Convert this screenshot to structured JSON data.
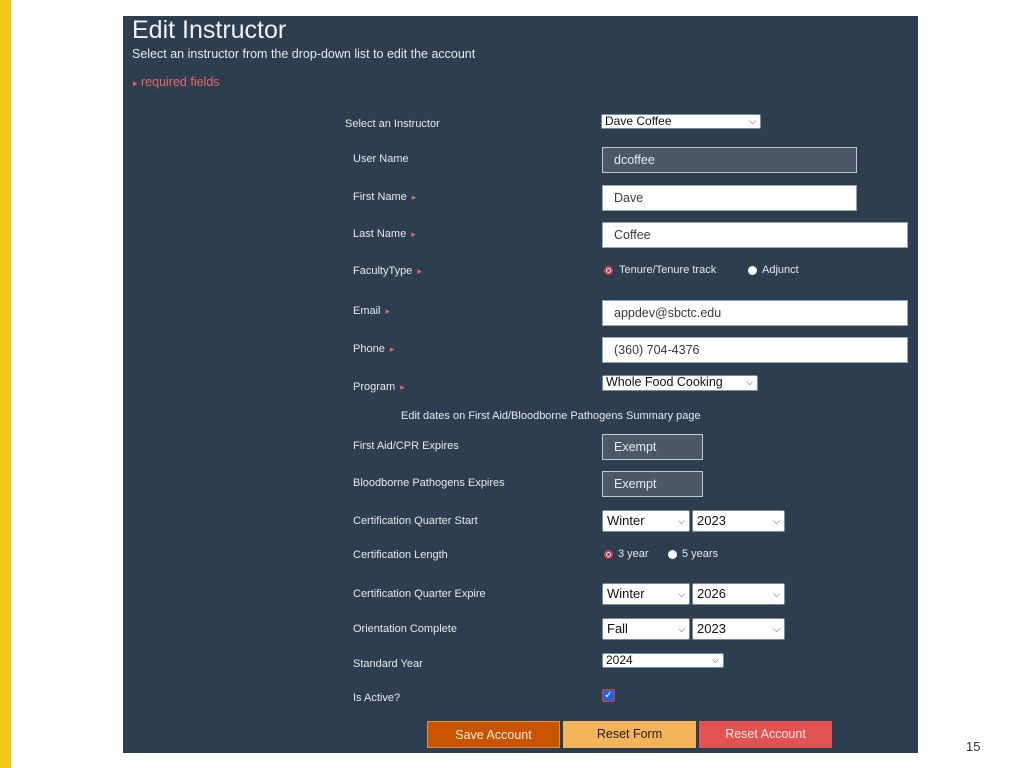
{
  "page": {
    "title": "Edit Instructor",
    "subtitle": "Select an instructor from the drop-down list to edit the account",
    "required_note": "required fields",
    "required_marker": "▸",
    "page_number": "15"
  },
  "colors": {
    "panel_bg": "#2d3e50",
    "accent_yellow": "#f5c518",
    "required_red": "#e46767",
    "save_button": "#c85400",
    "reset_form_button": "#f4b55a",
    "reset_account_button": "#e35252"
  },
  "form": {
    "select_instructor": {
      "label": "Select an Instructor",
      "value": "Dave Coffee"
    },
    "user_name": {
      "label": "User Name",
      "value": "dcoffee"
    },
    "first_name": {
      "label": "First Name",
      "value": "Dave"
    },
    "last_name": {
      "label": "Last Name",
      "value": "Coffee"
    },
    "faculty_type": {
      "label": "FacultyType",
      "options": [
        "Tenure/Tenure track",
        "Adjunct"
      ],
      "selected": "Tenure/Tenure track"
    },
    "email": {
      "label": "Email",
      "value": "appdev@sbctc.edu"
    },
    "phone": {
      "label": "Phone",
      "value": "(360) 704-4376"
    },
    "program": {
      "label": "Program",
      "value": "Whole Food Cooking"
    },
    "dates_note": "Edit dates on First Aid/Bloodborne Pathogens Summary page",
    "first_aid": {
      "label": "First Aid/CPR Expires",
      "value": "Exempt"
    },
    "bloodborne": {
      "label": "Bloodborne Pathogens Expires",
      "value": "Exempt"
    },
    "cert_start": {
      "label": "Certification Quarter Start",
      "quarter": "Winter",
      "year": "2023"
    },
    "cert_length": {
      "label": "Certification Length",
      "options": [
        "3 year",
        "5 years"
      ],
      "selected": "3 year"
    },
    "cert_expire": {
      "label": "Certification Quarter Expire",
      "quarter": "Winter",
      "year": "2026"
    },
    "orientation": {
      "label": "Orientation Complete",
      "quarter": "Fall",
      "year": "2023"
    },
    "standard_year": {
      "label": "Standard Year",
      "value": "2024"
    },
    "is_active": {
      "label": "Is Active?",
      "checked": true,
      "check_glyph": "✓"
    }
  },
  "buttons": {
    "save": "Save Account",
    "reset_form": "Reset Form",
    "reset_account": "Reset Account"
  }
}
